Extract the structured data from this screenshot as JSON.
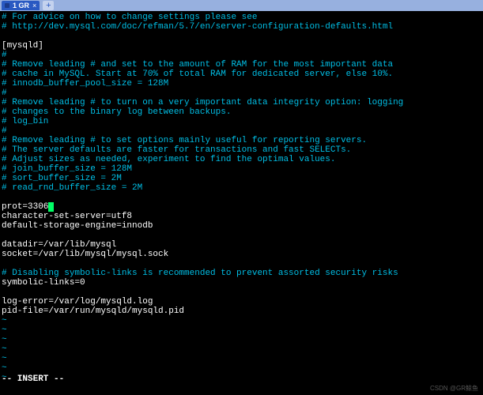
{
  "tab": {
    "title": "1 GR",
    "close": "×",
    "add": "+"
  },
  "lines": [
    {
      "cls": "comment",
      "text": "# For advice on how to change settings please see"
    },
    {
      "cls": "comment",
      "text": "# http://dev.mysql.com/doc/refman/5.7/en/server-configuration-defaults.html"
    },
    {
      "cls": "plain",
      "text": ""
    },
    {
      "cls": "plain",
      "text": "[mysqld]"
    },
    {
      "cls": "comment",
      "text": "#"
    },
    {
      "cls": "comment",
      "text": "# Remove leading # and set to the amount of RAM for the most important data"
    },
    {
      "cls": "comment",
      "text": "# cache in MySQL. Start at 70% of total RAM for dedicated server, else 10%."
    },
    {
      "cls": "comment",
      "text": "# innodb_buffer_pool_size = 128M"
    },
    {
      "cls": "comment",
      "text": "#"
    },
    {
      "cls": "comment",
      "text": "# Remove leading # to turn on a very important data integrity option: logging"
    },
    {
      "cls": "comment",
      "text": "# changes to the binary log between backups."
    },
    {
      "cls": "comment",
      "text": "# log_bin"
    },
    {
      "cls": "comment",
      "text": "#"
    },
    {
      "cls": "comment",
      "text": "# Remove leading # to set options mainly useful for reporting servers."
    },
    {
      "cls": "comment",
      "text": "# The server defaults are faster for transactions and fast SELECTs."
    },
    {
      "cls": "comment",
      "text": "# Adjust sizes as needed, experiment to find the optimal values."
    },
    {
      "cls": "comment",
      "text": "# join_buffer_size = 128M"
    },
    {
      "cls": "comment",
      "text": "# sort_buffer_size = 2M"
    },
    {
      "cls": "comment",
      "text": "# read_rnd_buffer_size = 2M"
    },
    {
      "cls": "plain",
      "text": ""
    },
    {
      "cls": "plain",
      "text": "prot=3306",
      "cursor": true
    },
    {
      "cls": "plain",
      "text": "character-set-server=utf8"
    },
    {
      "cls": "plain",
      "text": "default-storage-engine=innodb"
    },
    {
      "cls": "plain",
      "text": ""
    },
    {
      "cls": "plain",
      "text": "datadir=/var/lib/mysql"
    },
    {
      "cls": "plain",
      "text": "socket=/var/lib/mysql/mysql.sock"
    },
    {
      "cls": "plain",
      "text": ""
    },
    {
      "cls": "comment",
      "text": "# Disabling symbolic-links is recommended to prevent assorted security risks"
    },
    {
      "cls": "plain",
      "text": "symbolic-links=0"
    },
    {
      "cls": "plain",
      "text": ""
    },
    {
      "cls": "plain",
      "text": "log-error=/var/log/mysqld.log"
    },
    {
      "cls": "plain",
      "text": "pid-file=/var/run/mysqld/mysqld.pid"
    },
    {
      "cls": "tilde",
      "text": "~"
    },
    {
      "cls": "tilde",
      "text": "~"
    },
    {
      "cls": "tilde",
      "text": "~"
    },
    {
      "cls": "tilde",
      "text": "~"
    },
    {
      "cls": "tilde",
      "text": "~"
    },
    {
      "cls": "tilde",
      "text": "~"
    },
    {
      "cls": "tilde",
      "text": "~"
    }
  ],
  "status": "-- INSERT --",
  "watermark": "CSDN @GR鲸鱼"
}
